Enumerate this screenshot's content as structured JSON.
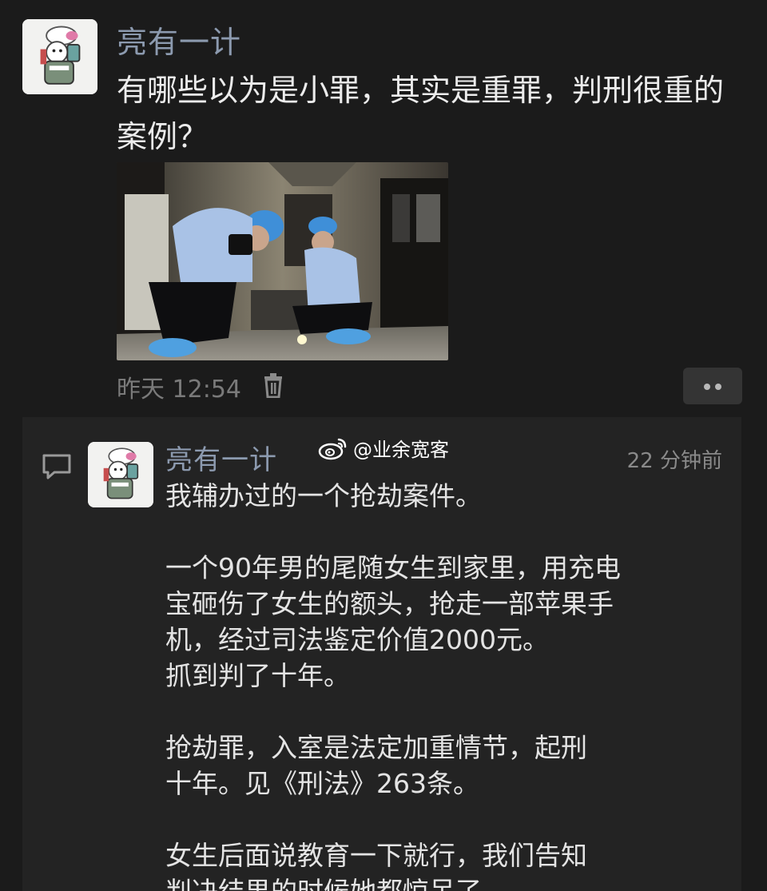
{
  "post": {
    "author": "亮有一计",
    "text": "有哪些以为是小罪，其实是重罪，判刑很重的案例？",
    "time": "昨天 12:54"
  },
  "comment": {
    "author": "亮有一计",
    "watermark": "@业余宽客",
    "time": "22 分钟前",
    "paragraphs": [
      "我辅办过的一个抢劫案件。",
      "一个90年男的尾随女生到家里，用充电\n宝砸伤了女生的额头，抢走一部苹果手\n机，经过司法鉴定价值2000元。\n抓到判了十年。",
      "抢劫罪，入室是法定加重情节，起刑\n十年。见《刑法》263条。",
      "女生后面说教育一下就行，我们告知\n判决结果的时候她都惊呆了。"
    ]
  },
  "colors": {
    "background": "#1b1b1b",
    "panel": "#232323",
    "author_name": "#8c9aaf",
    "body_text": "#e4e4e4",
    "meta_text": "#7a7a7a"
  },
  "icons": {
    "delete": "trash-icon",
    "more": "more-dots-icon",
    "comment": "comment-bubble-icon",
    "watermark": "weibo-icon"
  }
}
